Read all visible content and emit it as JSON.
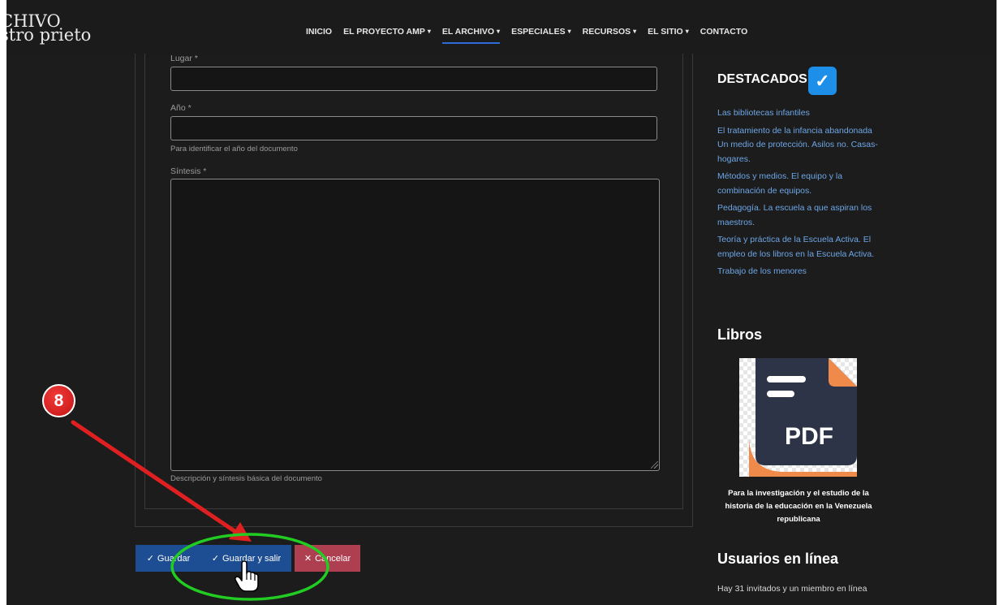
{
  "logo": {
    "line1": "CHIVO",
    "line2": "stro prieto"
  },
  "nav": {
    "items": [
      {
        "label": "INICIO",
        "dropdown": false,
        "active": false
      },
      {
        "label": "EL PROYECTO AMP",
        "dropdown": true,
        "active": false
      },
      {
        "label": "EL ARCHIVO",
        "dropdown": true,
        "active": true
      },
      {
        "label": "ESPECIALES",
        "dropdown": true,
        "active": false
      },
      {
        "label": "RECURSOS",
        "dropdown": true,
        "active": false
      },
      {
        "label": "EL SITIO",
        "dropdown": true,
        "active": false
      },
      {
        "label": "CONTACTO",
        "dropdown": false,
        "active": false
      }
    ],
    "caret": "▾"
  },
  "form": {
    "lugar": {
      "label": "Lugar *",
      "value": ""
    },
    "anio": {
      "label": "Año *",
      "value": "",
      "hint": "Para identificar el año del documento"
    },
    "sintesis": {
      "label": "Síntesis *",
      "value": "",
      "hint": "Descripción y síntesis básica del documento"
    }
  },
  "buttons": {
    "save": {
      "icon": "✓",
      "label": "Guardar"
    },
    "save_exit": {
      "icon": "✓",
      "label": "Guardar y salir"
    },
    "cancel": {
      "icon": "✕",
      "label": "Cancelar"
    }
  },
  "sidebar": {
    "destacados_title": "DESTACADOS",
    "destacados_icon": "check-badge-icon",
    "destacados": [
      "Las bibliotecas infantiles",
      "El tratamiento de la infancia abandonada Un medio de protección. Asilos no. Casas-hogares.",
      "Métodos y medios. El equipo y la combinación de equipos.",
      "Pedagogía. La escuela a que aspiran los maestros.",
      "Teoría y práctica de la Escuela Activa. El empleo de los libros en la Escuela Activa.",
      "Trabajo de los menores"
    ],
    "libros_title": "Libros",
    "pdf_label": "PDF",
    "libros_caption": "Para la investigación y el estudio de la historia de la educación en la Venezuela republicana",
    "usuarios_title": "Usuarios en línea",
    "usuarios_text": "Hay 31 invitados y un miembro en línea"
  },
  "annotation": {
    "step_number": "8"
  },
  "colors": {
    "background": "#1c1c1c",
    "primary_button": "#1d4d93",
    "cancel_button": "#ad3f50",
    "link": "#6da6e6",
    "annotation_red": "#e02020",
    "annotation_green": "#22cc22"
  }
}
